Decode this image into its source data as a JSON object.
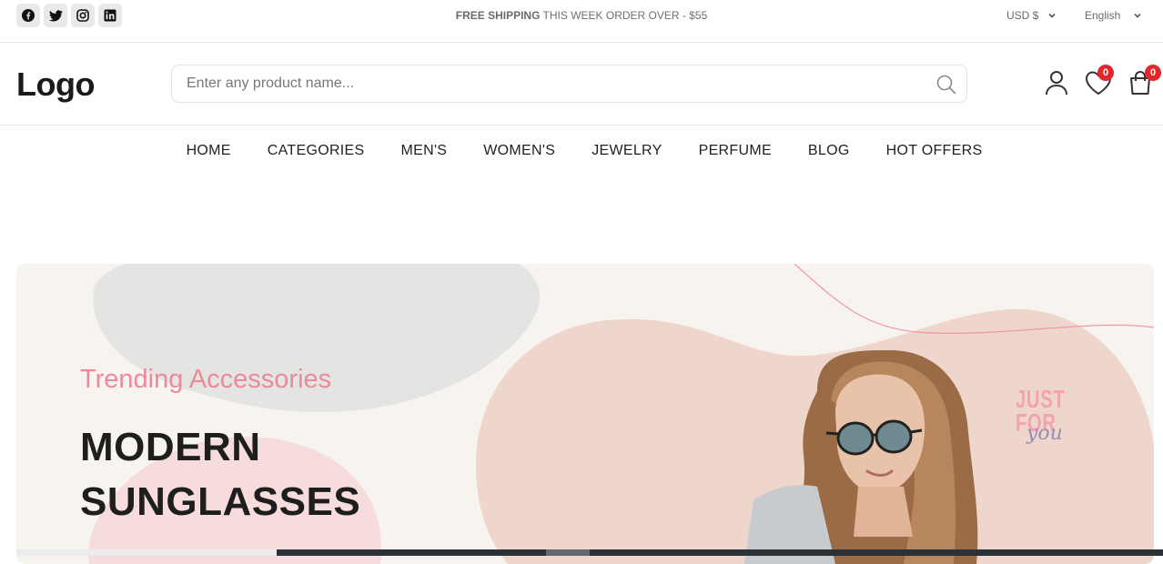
{
  "topbar": {
    "social": [
      {
        "name": "facebook-icon"
      },
      {
        "name": "twitter-icon"
      },
      {
        "name": "instagram-icon"
      },
      {
        "name": "linkedin-icon"
      }
    ],
    "shipping_bold": "FREE SHIPPING",
    "shipping_text": " THIS WEEK ORDER OVER - $55",
    "currency": "USD $",
    "language": "English"
  },
  "header": {
    "logo": "Logo",
    "search_placeholder": "Enter any product name...",
    "wishlist_count": "0",
    "cart_count": "0"
  },
  "nav": {
    "items": [
      "HOME",
      "CATEGORIES",
      "MEN'S",
      "WOMEN'S",
      "JEWELRY",
      "PERFUME",
      "BLOG",
      "HOT OFFERS"
    ]
  },
  "banner": {
    "subtitle": "Trending Accessories",
    "title_line1": "MODERN",
    "title_line2": "SUNGLASSES",
    "stamp_line1": "JUST",
    "stamp_line2": "FOR",
    "stamp_line3": "you"
  },
  "colors": {
    "accent_pink": "#ec8a99",
    "badge_red": "#e2272a",
    "banner_bg": "#f7f3ef"
  }
}
